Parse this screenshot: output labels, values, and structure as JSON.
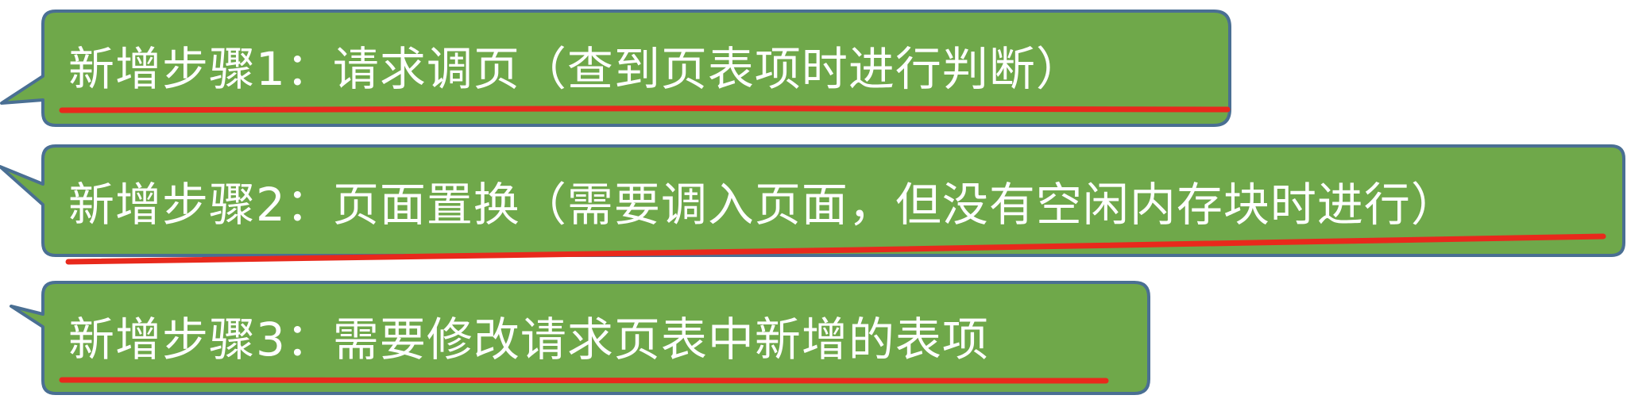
{
  "callouts": [
    {
      "text": "新增步骤1：请求调页（查到页表项时进行判断）"
    },
    {
      "text": "新增步骤2：页面置换（需要调入页面，但没有空闲内存块时进行）"
    },
    {
      "text": "新增步骤3：需要修改请求页表中新增的表项"
    }
  ],
  "colors": {
    "callout_fill": "#6fa84a",
    "callout_border": "#4a6f93",
    "text": "#ffffff",
    "underline": "#e8291c"
  }
}
